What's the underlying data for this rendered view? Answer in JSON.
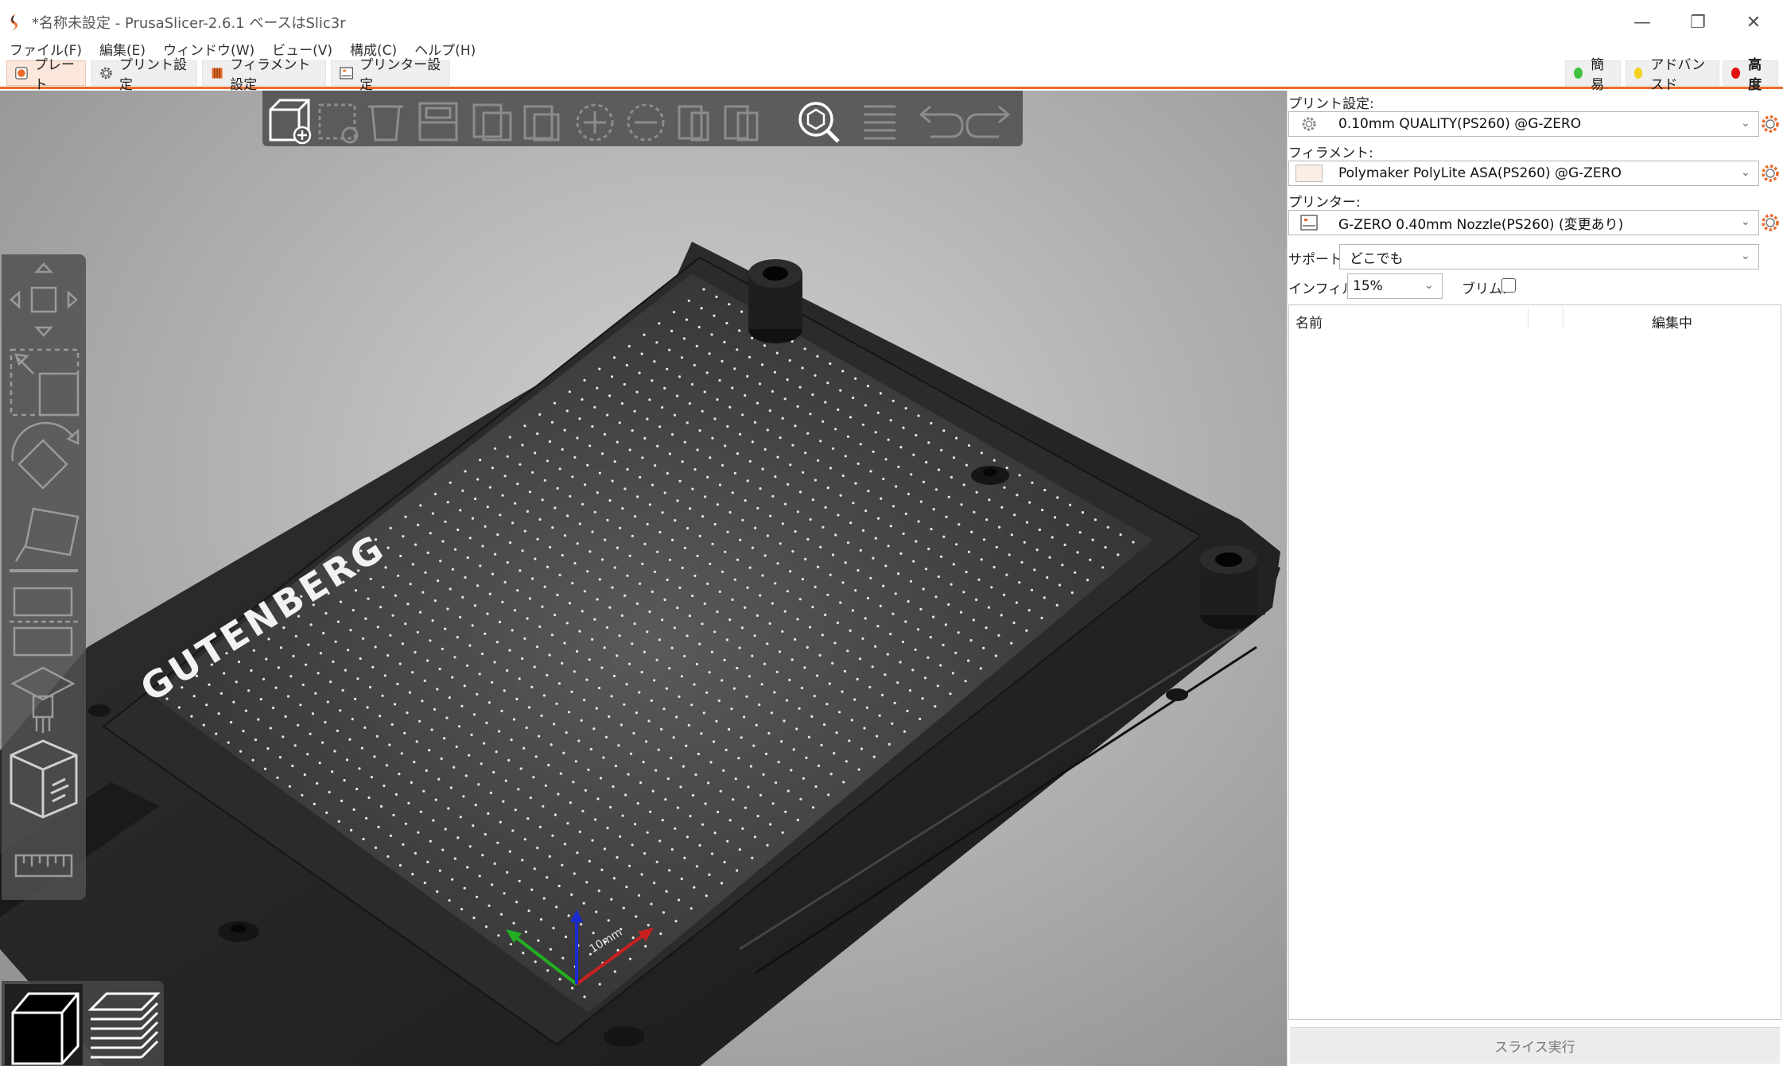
{
  "window": {
    "title": "*名称未設定 - PrusaSlicer-2.6.1 ベースはSlic3r",
    "minimize": "—",
    "maximize": "❐",
    "close": "✕"
  },
  "menu": [
    "ファイル(F)",
    "編集(E)",
    "ウィンドウ(W)",
    "ビュー(V)",
    "構成(C)",
    "ヘルプ(H)"
  ],
  "tabs": [
    {
      "label": "プレート",
      "icon": "plate-icon",
      "active": true
    },
    {
      "label": "プリント設定",
      "icon": "gear-icon"
    },
    {
      "label": "フィラメント設定",
      "icon": "filament-spool-icon"
    },
    {
      "label": "プリンター設定",
      "icon": "printer-icon"
    }
  ],
  "modes": [
    {
      "label": "簡易",
      "color": "#3fc33f"
    },
    {
      "label": "アドバンスド",
      "color": "#f2d21b"
    },
    {
      "label": "高度",
      "color": "#e01010"
    }
  ],
  "scene": {
    "bed_logo": "GUTENBERG",
    "scale_label": "10mm"
  },
  "sidebar": {
    "print_settings_label": "プリント設定:",
    "print_profile": "0.10mm QUALITY(PS260) @G-ZERO",
    "filament_label": "フィラメント:",
    "filament_profile": "Polymaker PolyLite ASA(PS260) @G-ZERO",
    "filament_color": "#fbeee4",
    "printer_label": "プリンター:",
    "printer_profile": "G-ZERO 0.40mm Nozzle(PS260) (変更あり)",
    "support_label": "サポート:",
    "support_value": "どこでも",
    "infill_label": "インフィル:",
    "infill_value": "15%",
    "brim_label": "ブリム:",
    "brim_checked": false,
    "list_columns": {
      "name": "名前",
      "editing": "編集中"
    },
    "slice_button": "スライス実行"
  },
  "colors": {
    "accent": "#ec6a2a"
  }
}
